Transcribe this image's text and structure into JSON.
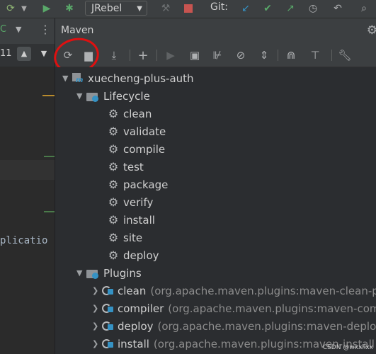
{
  "toolbar": {
    "run_config": "JRebel",
    "git_label": "Git:",
    "icons": [
      "refresh-run-icon",
      "arrow-icon",
      "run-icon",
      "debug-icon",
      "hammer-icon",
      "stop-icon",
      "git-update-icon",
      "git-commit-icon",
      "git-push-icon",
      "history-icon",
      "undo-icon",
      "search-icon"
    ]
  },
  "editor": {
    "line_number": "11",
    "code_fragment": "plicatio"
  },
  "maven": {
    "title": "Maven",
    "project": "xuecheng-plus-auth",
    "lifecycle_label": "Lifecycle",
    "lifecycle": [
      "clean",
      "validate",
      "compile",
      "test",
      "package",
      "verify",
      "install",
      "site",
      "deploy"
    ],
    "plugins_label": "Plugins",
    "plugins": [
      {
        "name": "clean",
        "coord": "(org.apache.maven.plugins:maven-clean-pl"
      },
      {
        "name": "compiler",
        "coord": "(org.apache.maven.plugins:maven-com"
      },
      {
        "name": "deploy",
        "coord": "(org.apache.maven.plugins:maven-deploy"
      },
      {
        "name": "install",
        "coord": "(org.apache.maven.plugins:maven-install"
      }
    ]
  },
  "watermark": "CSDN @wxxllxx",
  "colors": {
    "accent": "#3592c4",
    "annotation": "#e01010",
    "green": "#4caf50"
  }
}
